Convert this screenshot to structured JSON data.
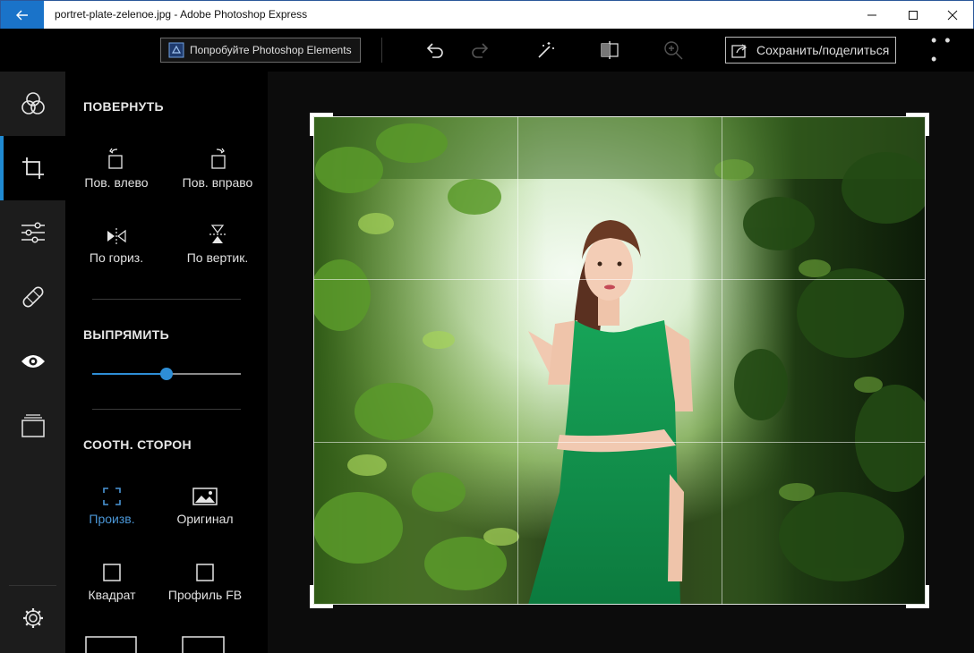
{
  "window": {
    "title": "portret-plate-zelenoe.jpg - Adobe Photoshop Express"
  },
  "toolbar": {
    "promo_label": "Попробуйте Photoshop Elements",
    "save_label": "Сохранить/поделиться",
    "more_label": "• • •"
  },
  "panel": {
    "rotate": {
      "title": "ПОВЕРНУТЬ",
      "rotate_left": "Пов. влево",
      "rotate_right": "Пов. вправо",
      "flip_h": "По гориз.",
      "flip_v": "По вертик."
    },
    "straighten": {
      "title": "ВЫПРЯМИТЬ",
      "value": 0.5
    },
    "aspect": {
      "title": "СООТН. СТОРОН",
      "items": [
        "Произв.",
        "Оригинал",
        "Квадрат",
        "Профиль FB"
      ]
    }
  },
  "nav": {
    "items": [
      "looks-icon",
      "crop-icon",
      "adjustments-icon",
      "heal-icon",
      "redeye-icon",
      "borders-icon",
      "settings-icon"
    ],
    "active": "crop-icon"
  },
  "colors": {
    "accent": "#1f8ad2",
    "titlebar_back": "#1a73c9",
    "background": "#000000"
  }
}
